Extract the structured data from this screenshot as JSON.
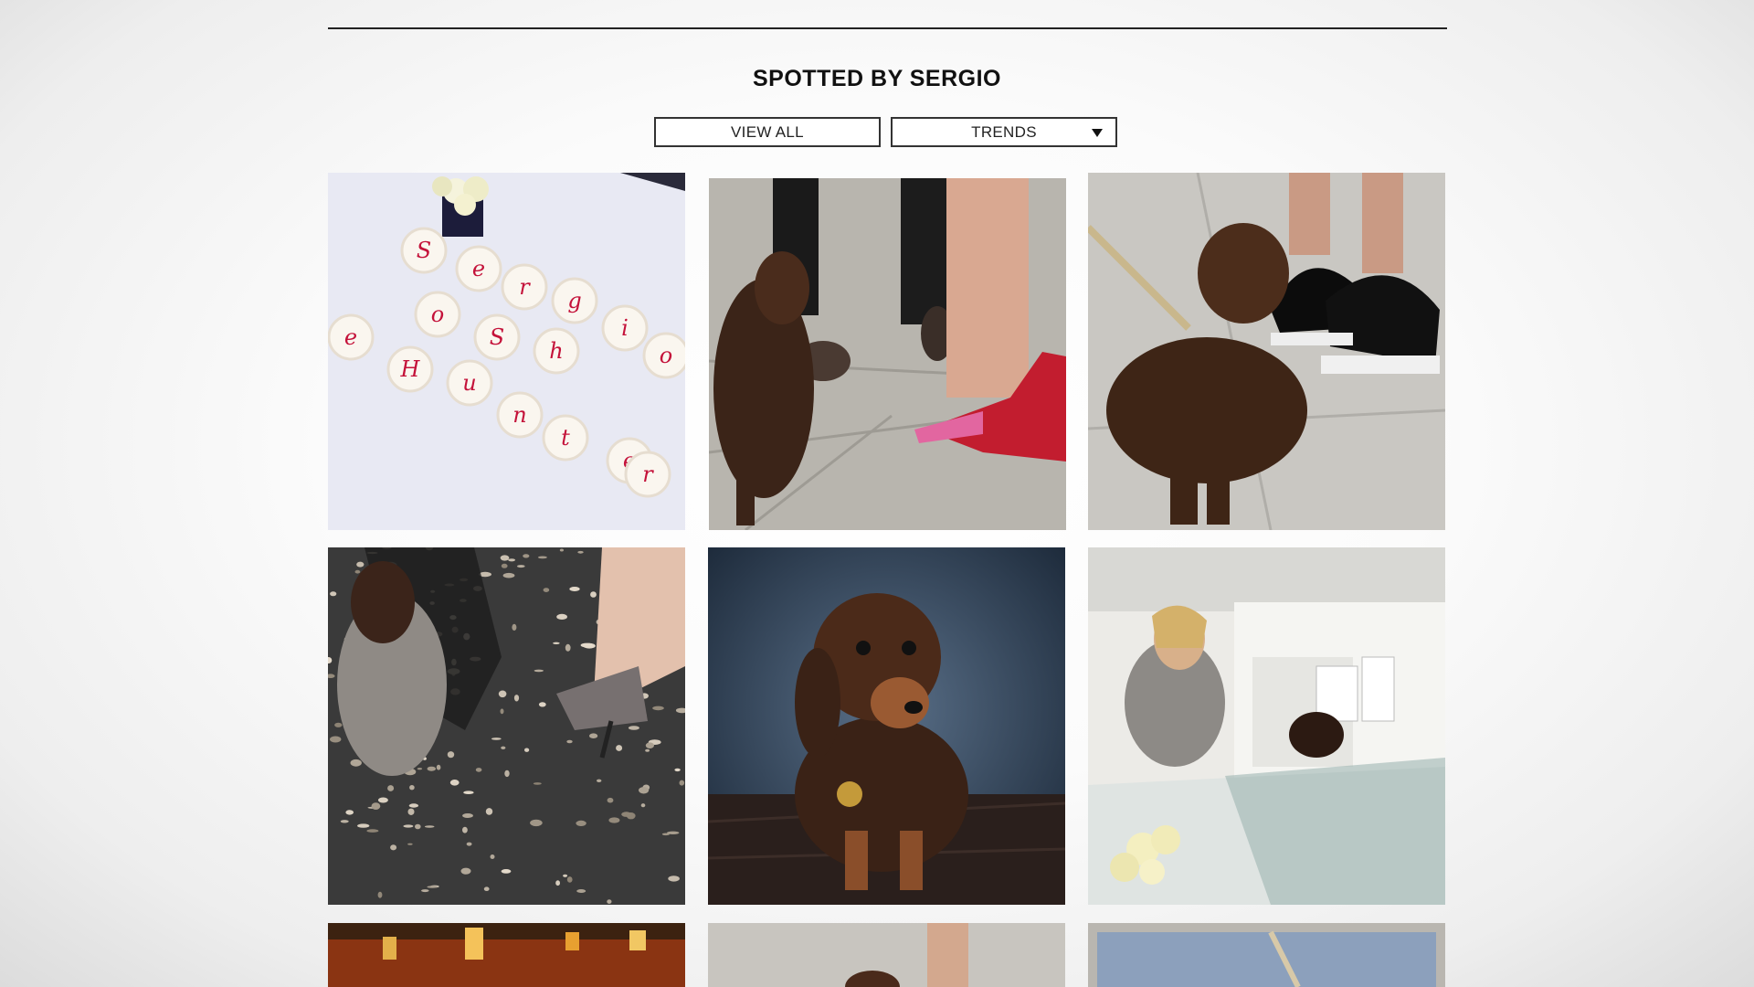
{
  "section": {
    "title": "SPOTTED BY SERGIO"
  },
  "filters": {
    "view_all_label": "VIEW ALL",
    "trends_label": "TRENDS"
  },
  "cupcake_letters": [
    "S",
    "e",
    "r",
    "g",
    "i",
    "o",
    "S",
    "h",
    "o",
    "e",
    "H",
    "u",
    "n",
    "t",
    "e",
    "r"
  ]
}
